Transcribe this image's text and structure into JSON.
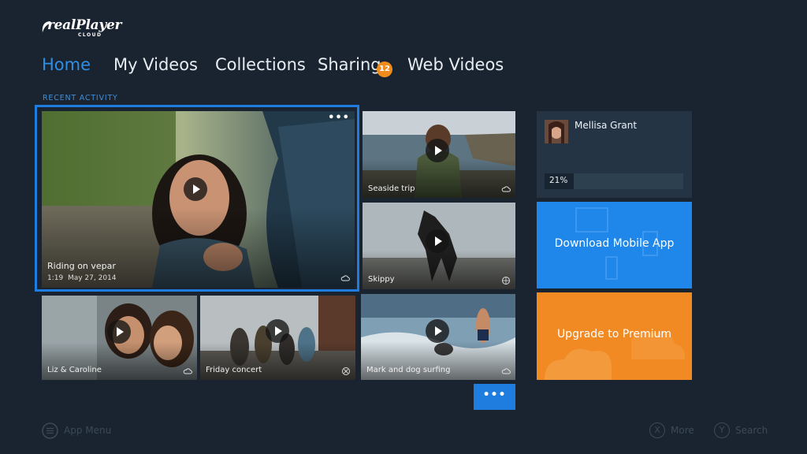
{
  "app": {
    "logo_text": "realPlayer",
    "logo_subtext": "CLOUD"
  },
  "nav": {
    "home": "Home",
    "my_videos": "My Videos",
    "collections": "Collections",
    "sharing": "Sharing",
    "sharing_badge": "12",
    "web_videos": "Web Videos"
  },
  "section_label": "RECENT ACTIVITY",
  "videos": {
    "featured": {
      "title": "Riding on vepar",
      "duration": "1:19",
      "date": "May 27, 2014",
      "status_icon": "cloud-icon"
    },
    "seaside": {
      "title": "Seaside trip",
      "status_icon": "cloud-icon"
    },
    "skippy": {
      "title": "Skippy",
      "status_icon": "globe-icon"
    },
    "liz": {
      "title": "Liz & Caroline",
      "status_icon": "cloud-icon"
    },
    "concert": {
      "title": "Friday concert",
      "status_icon": "xbox-icon"
    },
    "surf": {
      "title": "Mark and dog surfing",
      "status_icon": "cloud-icon"
    }
  },
  "user": {
    "name": "Mellisa Grant",
    "progress_text": "21%",
    "progress_fraction": 0.21
  },
  "promos": {
    "download": "Download Mobile App",
    "premium": "Upgrade to Premium"
  },
  "more_dots": "•••",
  "hints": {
    "app_menu": "App Menu",
    "more_key": "X",
    "more": "More",
    "search_key": "Y",
    "search": "Search"
  },
  "colors": {
    "background": "#1a2430",
    "accent": "#1f7de0",
    "badge": "#f08c1c",
    "download_tile": "#1f86ea",
    "premium_tile": "#f18a22"
  }
}
